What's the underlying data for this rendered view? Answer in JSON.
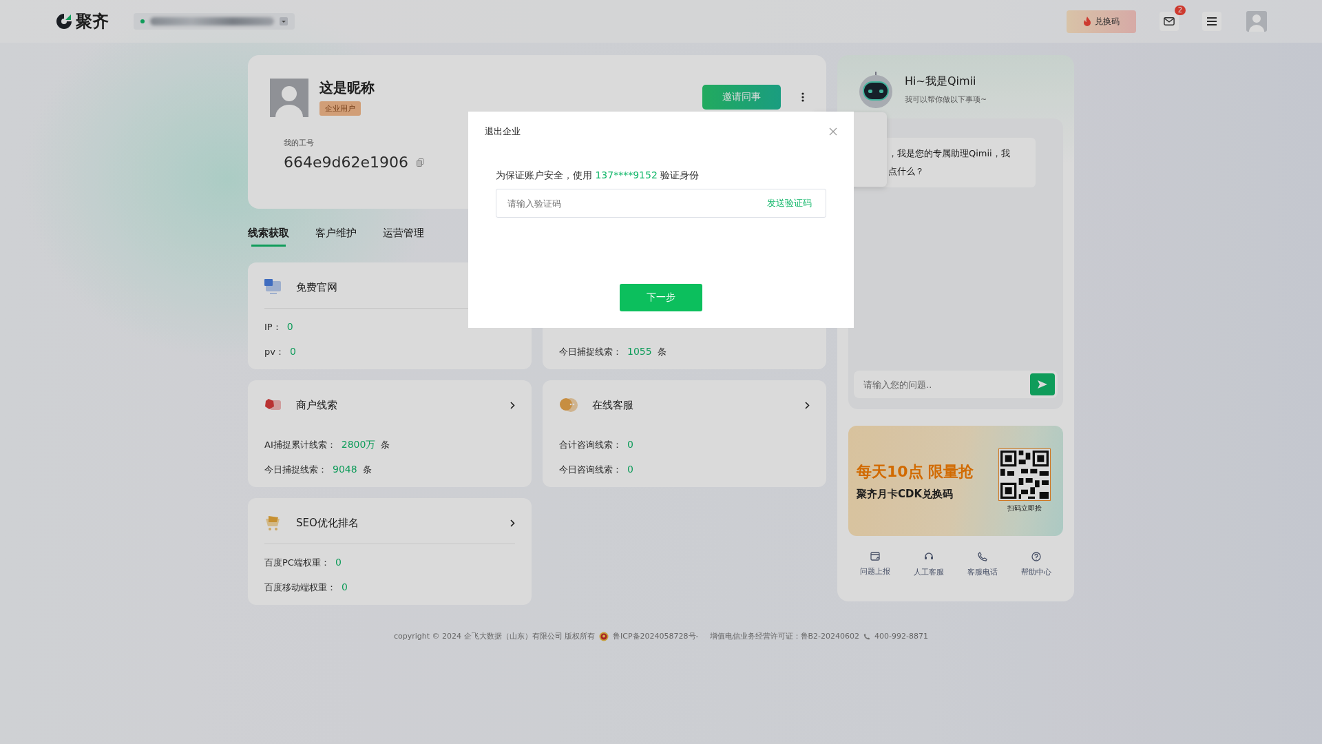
{
  "header": {
    "logo": "聚齐",
    "redeem_button": "兑换码",
    "mail_badge": "2"
  },
  "profile": {
    "nickname": "这是昵称",
    "badge": "企业用户",
    "id_label": "我的工号",
    "id_value": "664e9d62e1906",
    "invite_button": "邀请同事"
  },
  "tabs": [
    {
      "label": "线索获取",
      "selected": true
    },
    {
      "label": "客户维护",
      "selected": false
    },
    {
      "label": "运营管理",
      "selected": false
    }
  ],
  "cards": [
    {
      "title": "免费官网",
      "kind": "monitor",
      "arrow": false,
      "divider": true,
      "stats": [
        {
          "label": "IP：",
          "value": "0"
        },
        {
          "label": "pv：",
          "value": "0"
        }
      ]
    },
    {
      "stats": [
        {
          "label": "今日捕捉线索：",
          "value": "1055",
          "unit": "条"
        }
      ]
    },
    {
      "title": "商户线索",
      "kind": "tag",
      "arrow": true,
      "divider": false,
      "stats": [
        {
          "label": "AI捕捉累计线索：",
          "value": "2800万",
          "unit": "条"
        },
        {
          "label": "今日捕捉线索：",
          "value": "9048",
          "unit": "条"
        }
      ]
    },
    {
      "title": "在线客服",
      "kind": "chat",
      "arrow": true,
      "divider": false,
      "stats": [
        {
          "label": "合计咨询线索：",
          "value": "0"
        },
        {
          "label": "今日咨询线索：",
          "value": "0"
        }
      ]
    },
    {
      "title": "SEO优化排名",
      "kind": "cart",
      "arrow": true,
      "divider": true,
      "stats": [
        {
          "label": "百度PC端权重：",
          "value": "0"
        },
        {
          "label": "百度移动端权重：",
          "value": "0"
        }
      ]
    }
  ],
  "assistant": {
    "title": "Hi~我是Qimii",
    "subtitle": "我可以帮你做以下事项~",
    "bubble_lines": [
      "，我是您的专属助理Qimii，我",
      "点什么？"
    ],
    "input_placeholder": "请输入您的问题.."
  },
  "banner": {
    "line1": "每天10点 限量抢",
    "line2": "聚齐月卡CDK兑换码",
    "qr_caption": "扫码立即抢"
  },
  "links": [
    {
      "label": "问题上报",
      "kind": "report"
    },
    {
      "label": "人工客服",
      "kind": "headset"
    },
    {
      "label": "客服电话",
      "kind": "phone"
    },
    {
      "label": "帮助中心",
      "kind": "help"
    }
  ],
  "footer": {
    "copyright": "copyright © 2024 企飞大数据（山东）有限公司 版权所有",
    "icp": "鲁ICP备2024058728号-",
    "license": "增值电信业务经营许可证：鲁B2-20240602",
    "phone": "400-992-8871"
  },
  "modal": {
    "title": "退出企业",
    "message_before": "为保证账户安全，使用",
    "phone": "137****9152",
    "message_after": "验证身份",
    "placeholder": "请输入验证码",
    "send_code": "发送验证码",
    "next_button": "下一步"
  }
}
